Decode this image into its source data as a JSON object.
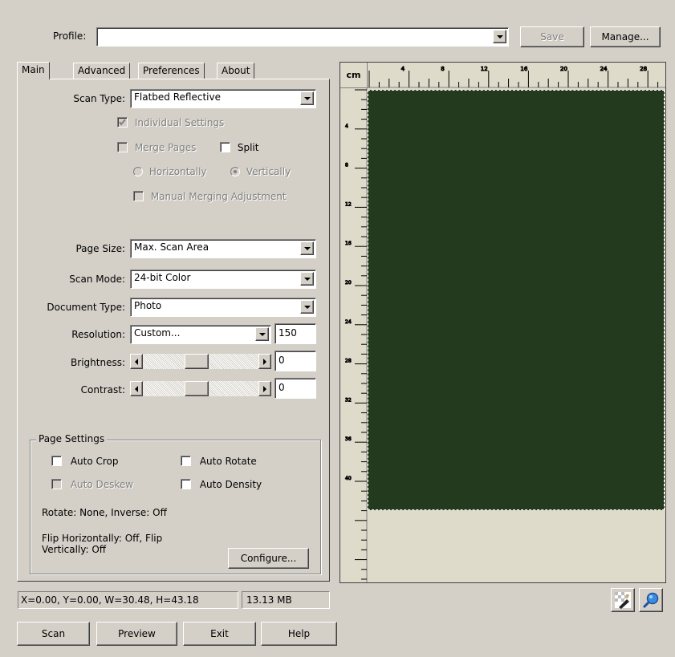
{
  "profile": {
    "label": "Profile:",
    "value": ""
  },
  "top_buttons": {
    "save": "Save",
    "manage": "Manage..."
  },
  "tabs": [
    "Main",
    "Advanced",
    "Preferences",
    "About"
  ],
  "main": {
    "scan_type": {
      "label": "Scan Type:",
      "value": "Flatbed Reflective"
    },
    "individual_settings": {
      "label": "Individual Settings",
      "checked": true,
      "enabled": false
    },
    "merge_pages": {
      "label": "Merge Pages",
      "checked": false,
      "enabled": false
    },
    "split": {
      "label": "Split",
      "checked": false
    },
    "horizontally": {
      "label": "Horizontally",
      "selected": false
    },
    "vertically": {
      "label": "Vertically",
      "selected": true
    },
    "manual_merging": {
      "label": "Manual Merging Adjustment",
      "checked": false
    },
    "page_size": {
      "label": "Page Size:",
      "value": "Max. Scan Area"
    },
    "scan_mode": {
      "label": "Scan Mode:",
      "value": "24-bit Color"
    },
    "document_type": {
      "label": "Document Type:",
      "value": "Photo"
    },
    "resolution": {
      "label": "Resolution:",
      "value": "Custom...",
      "number": "150"
    },
    "brightness": {
      "label": "Brightness:",
      "value": "0"
    },
    "contrast": {
      "label": "Contrast:",
      "value": "0"
    }
  },
  "page_settings": {
    "title": "Page Settings",
    "auto_crop": "Auto Crop",
    "auto_rotate": "Auto Rotate",
    "auto_deskew": "Auto Deskew",
    "auto_density": "Auto Density",
    "rotate_text": "Rotate: None, Inverse: Off",
    "flip_text": "Flip Horizontally: Off, Flip Vertically: Off",
    "configure": "Configure..."
  },
  "status": {
    "coords": "X=0.00, Y=0.00, W=30.48, H=43.18",
    "size": "13.13 MB"
  },
  "bottom_buttons": {
    "scan": "Scan",
    "preview": "Preview",
    "exit": "Exit",
    "help": "Help"
  },
  "ruler": {
    "unit": "cm",
    "top_ticks": [
      "4",
      "8",
      "12",
      "16",
      "20",
      "24",
      "28"
    ],
    "left_ticks": [
      "4",
      "8",
      "12",
      "16",
      "20",
      "24",
      "28",
      "32",
      "36",
      "40"
    ]
  },
  "preview": {
    "image_color": "#243a1f",
    "background": "#dedbcb"
  }
}
